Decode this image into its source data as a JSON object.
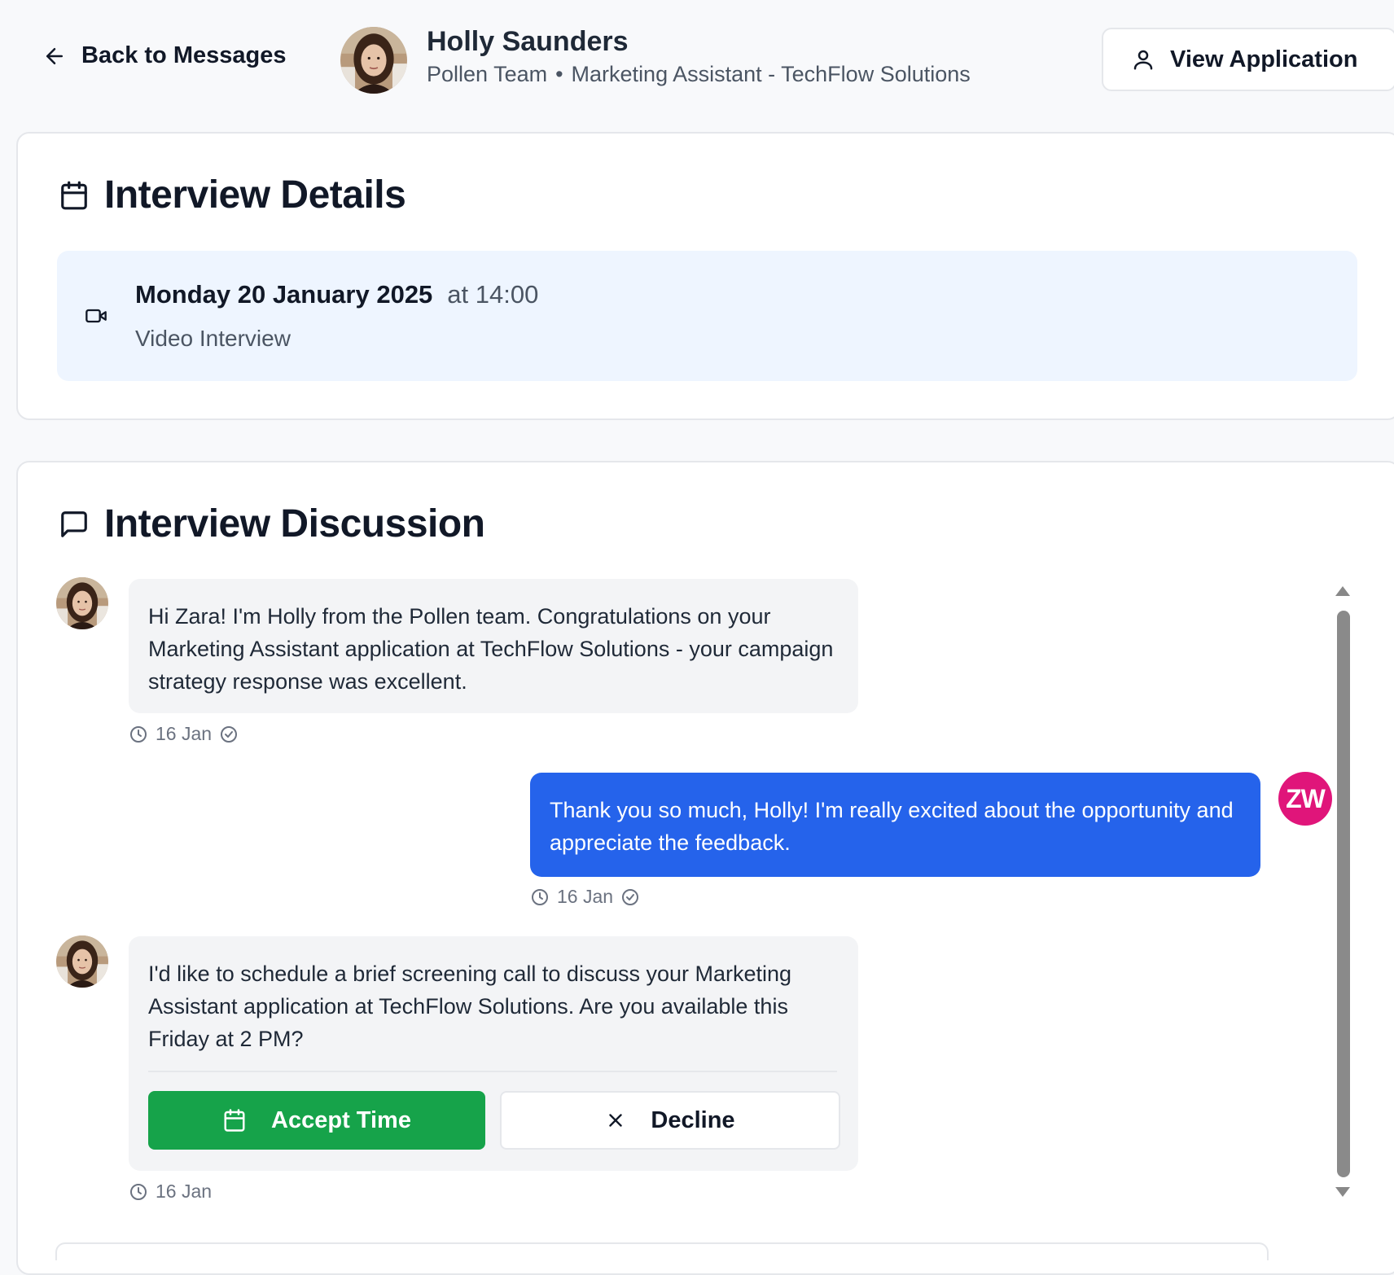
{
  "header": {
    "back_label": "Back to Messages",
    "name": "Holly Saunders",
    "team": "Pollen Team",
    "separator": "•",
    "role": "Marketing Assistant - TechFlow Solutions",
    "view_application_label": "View Application"
  },
  "details": {
    "title": "Interview Details",
    "date": "Monday 20 January 2025",
    "time": "at 14:00",
    "type": "Video Interview",
    "icon": "video-camera-icon"
  },
  "discussion": {
    "title": "Interview Discussion",
    "messages": [
      {
        "sender": "Holly",
        "text": "Hi Zara! I'm Holly from the Pollen team. Congratulations on your Marketing Assistant application at TechFlow Solutions - your campaign strategy response was excellent.",
        "date": "16 Jan",
        "read": true
      },
      {
        "sender": "Zara",
        "initials": "ZW",
        "text": "Thank you so much, Holly! I'm really excited about the opportunity and appreciate the feedback.",
        "date": "16 Jan",
        "read": true
      },
      {
        "sender": "Holly",
        "text": "I'd like to schedule a brief screening call to discuss your Marketing Assistant application at TechFlow Solutions. Are you available this Friday at 2 PM?",
        "date": "16 Jan",
        "read": false,
        "accept_label": "Accept Time",
        "decline_label": "Decline"
      }
    ]
  },
  "colors": {
    "accent_blue": "#2563eb",
    "accept_green": "#16a34a",
    "avatar_pink": "#e0157a",
    "details_bg": "#eef5ff"
  }
}
